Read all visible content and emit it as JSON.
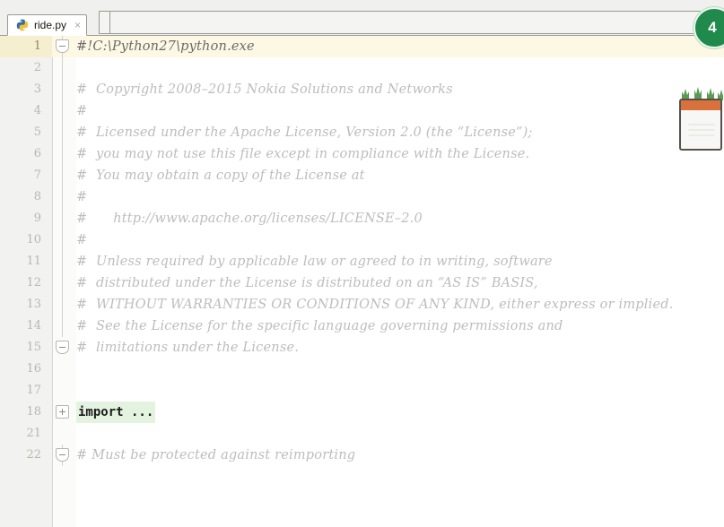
{
  "window": {
    "title": "ride.py"
  },
  "tabbar": {
    "tabs": [
      {
        "label": "ride.py",
        "icon": "python-file-icon",
        "close_label": "×",
        "active": true
      }
    ]
  },
  "badge": {
    "icon": "green-circle-badge",
    "value": "4",
    "color": "#1f8a4c"
  },
  "notepad": {
    "icon": "notepad-grass-widget",
    "top_color": "#d9713c",
    "grass_color": "#5a9a52"
  },
  "editor": {
    "language": "Python",
    "gutter_color": "#f2f2f0",
    "highlight_color": "#fdf8e3",
    "fold_highlight_color": "#e4f3e0",
    "comment_color": "#bdbdbd",
    "lines": [
      {
        "no": "1",
        "text": "#!C:\\Python27\\python.exe",
        "style": "shebang",
        "highlight": true,
        "fold": "start",
        "foldline": true
      },
      {
        "no": "2",
        "text": "",
        "style": "comment",
        "highlight": false,
        "fold": "none",
        "foldline": true
      },
      {
        "no": "3",
        "text": "#  Copyright 2008–2015 Nokia Solutions and Networks",
        "style": "comment",
        "highlight": false,
        "fold": "none",
        "foldline": true
      },
      {
        "no": "4",
        "text": "#",
        "style": "comment",
        "highlight": false,
        "fold": "none",
        "foldline": true
      },
      {
        "no": "5",
        "text": "#  Licensed under the Apache License, Version 2.0 (the “License”);",
        "style": "comment",
        "highlight": false,
        "fold": "none",
        "foldline": true
      },
      {
        "no": "6",
        "text": "#  you may not use this file except in compliance with the License.",
        "style": "comment",
        "highlight": false,
        "fold": "none",
        "foldline": true
      },
      {
        "no": "7",
        "text": "#  You may obtain a copy of the License at",
        "style": "comment",
        "highlight": false,
        "fold": "none",
        "foldline": true
      },
      {
        "no": "8",
        "text": "#",
        "style": "comment",
        "highlight": false,
        "fold": "none",
        "foldline": true
      },
      {
        "no": "9",
        "text": "#      http://www.apache.org/licenses/LICENSE–2.0",
        "style": "comment",
        "highlight": false,
        "fold": "none",
        "foldline": true
      },
      {
        "no": "10",
        "text": "#",
        "style": "comment",
        "highlight": false,
        "fold": "none",
        "foldline": true
      },
      {
        "no": "11",
        "text": "#  Unless required by applicable law or agreed to in writing, software",
        "style": "comment",
        "highlight": false,
        "fold": "none",
        "foldline": true
      },
      {
        "no": "12",
        "text": "#  distributed under the License is distributed on an “AS IS” BASIS,",
        "style": "comment",
        "highlight": false,
        "fold": "none",
        "foldline": true
      },
      {
        "no": "13",
        "text": "#  WITHOUT WARRANTIES OR CONDITIONS OF ANY KIND, either express or implied.",
        "style": "comment",
        "highlight": false,
        "fold": "none",
        "foldline": true
      },
      {
        "no": "14",
        "text": "#  See the License for the specific language governing permissions and",
        "style": "comment",
        "highlight": false,
        "fold": "none",
        "foldline": true
      },
      {
        "no": "15",
        "text": "#  limitations under the License.",
        "style": "comment",
        "highlight": false,
        "fold": "start",
        "foldline": false
      },
      {
        "no": "16",
        "text": "",
        "style": "comment",
        "highlight": false,
        "fold": "none",
        "foldline": false
      },
      {
        "no": "17",
        "text": "",
        "style": "comment",
        "highlight": false,
        "fold": "none",
        "foldline": false
      },
      {
        "no": "18",
        "text": "import ...",
        "style": "keyword",
        "highlight": false,
        "fold": "collapsed",
        "foldline": false
      },
      {
        "no": "21",
        "text": "",
        "style": "comment",
        "highlight": false,
        "fold": "none",
        "foldline": false
      },
      {
        "no": "22",
        "text": "# Must be protected against reimporting",
        "style": "comment",
        "highlight": false,
        "fold": "start",
        "foldline": true
      }
    ]
  }
}
